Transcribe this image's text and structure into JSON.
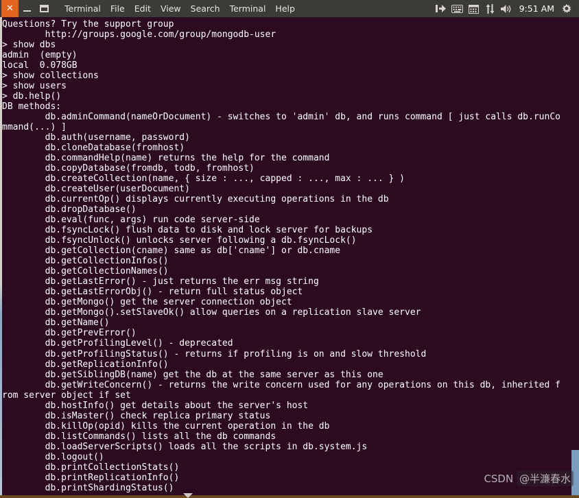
{
  "window": {
    "buttons": {
      "close_label": "✕",
      "minimize_label": "minimize",
      "maximize_label": "maximize"
    },
    "menu": [
      {
        "label": "Terminal"
      },
      {
        "label": "File"
      },
      {
        "label": "Edit"
      },
      {
        "label": "View"
      },
      {
        "label": "Search"
      },
      {
        "label": "Terminal"
      },
      {
        "label": "Help"
      }
    ]
  },
  "tray": {
    "icons": [
      {
        "name": "network-icon",
        "glyph": "❙▶"
      },
      {
        "name": "keyboard-icon",
        "glyph": "⌨"
      },
      {
        "name": "calendar-icon",
        "glyph": "Ὄ5"
      },
      {
        "name": "updown-arrows-icon",
        "glyph": "↑↓"
      },
      {
        "name": "volume-icon",
        "glyph": "ὐA"
      }
    ],
    "clock": "9:51 AM",
    "gear_glyph": "⚙"
  },
  "terminal": {
    "background_color": "#2b0a22",
    "foreground_color": "#ffffff",
    "lines": [
      "Questions? Try the support group",
      "        http://groups.google.com/group/mongodb-user",
      "> show dbs",
      "admin  (empty)",
      "local  0.078GB",
      "> show collections",
      "> show users",
      "> db.help()",
      "DB methods:",
      "        db.adminCommand(nameOrDocument) - switches to 'admin' db, and runs command [ just calls db.runCo",
      "mmand(...) ]",
      "        db.auth(username, password)",
      "        db.cloneDatabase(fromhost)",
      "        db.commandHelp(name) returns the help for the command",
      "        db.copyDatabase(fromdb, todb, fromhost)",
      "        db.createCollection(name, { size : ..., capped : ..., max : ... } )",
      "        db.createUser(userDocument)",
      "        db.currentOp() displays currently executing operations in the db",
      "        db.dropDatabase()",
      "        db.eval(func, args) run code server-side",
      "        db.fsyncLock() flush data to disk and lock server for backups",
      "        db.fsyncUnlock() unlocks server following a db.fsyncLock()",
      "        db.getCollection(cname) same as db['cname'] or db.cname",
      "        db.getCollectionInfos()",
      "        db.getCollectionNames()",
      "        db.getLastError() - just returns the err msg string",
      "        db.getLastErrorObj() - return full status object",
      "        db.getMongo() get the server connection object",
      "        db.getMongo().setSlaveOk() allow queries on a replication slave server",
      "        db.getName()",
      "        db.getPrevError()",
      "        db.getProfilingLevel() - deprecated",
      "        db.getProfilingStatus() - returns if profiling is on and slow threshold",
      "        db.getReplicationInfo()",
      "        db.getSiblingDB(name) get the db at the same server as this one",
      "        db.getWriteConcern() - returns the write concern used for any operations on this db, inherited f",
      "rom server object if set",
      "        db.hostInfo() get details about the server's host",
      "        db.isMaster() check replica primary status",
      "        db.killOp(opid) kills the current operation in the db",
      "        db.listCommands() lists all the db commands",
      "        db.loadServerScripts() loads all the scripts in db.system.js",
      "        db.logout()",
      "        db.printCollectionStats()",
      "        db.printReplicationInfo()",
      "        db.printShardingStatus()"
    ]
  },
  "watermark": {
    "prefix": "CSDN ",
    "handle": "@半濂春水"
  }
}
